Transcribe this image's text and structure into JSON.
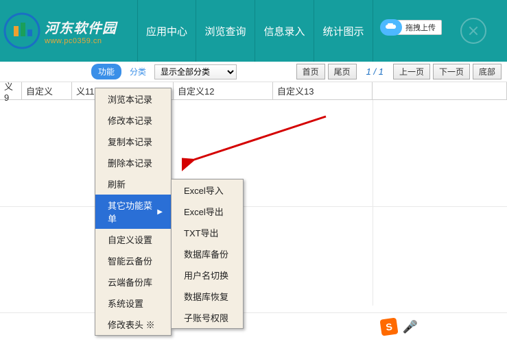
{
  "header": {
    "logo_title": "河东软件园",
    "logo_url": "www.pc0359.cn",
    "nav": [
      "应用中心",
      "浏览查询",
      "信息录入",
      "统计图示"
    ],
    "upload": "拖拽上传"
  },
  "toolbar": {
    "func_btn": "功能",
    "category_btn": "分类",
    "select_value": "显示全部分类",
    "first_page": "首页",
    "last_page": "尾页",
    "page_info": "1 / 1",
    "prev": "上一页",
    "next": "下一页",
    "bottom": "底部"
  },
  "table": {
    "headers": [
      "义9",
      "自定义",
      "义11",
      "自定义12",
      "自定义13"
    ]
  },
  "menu1": {
    "items": [
      {
        "label": "浏览本记录",
        "hl": false
      },
      {
        "label": "修改本记录",
        "hl": false
      },
      {
        "label": "复制本记录",
        "hl": false
      },
      {
        "label": "删除本记录",
        "hl": false
      },
      {
        "label": "刷新",
        "hl": false
      },
      {
        "label": "其它功能菜单",
        "hl": true,
        "arrow": true
      },
      {
        "label": "自定义设置",
        "hl": false
      },
      {
        "label": "智能云备份",
        "hl": false
      },
      {
        "label": "云端备份库",
        "hl": false
      },
      {
        "label": "系统设置",
        "hl": false
      },
      {
        "label": "修改表头 ※",
        "hl": false
      }
    ]
  },
  "menu2": {
    "items": [
      {
        "label": "Excel导入"
      },
      {
        "label": "Excel导出"
      },
      {
        "label": "TXT导出"
      },
      {
        "label": "数据库备份"
      },
      {
        "label": "用户名切换"
      },
      {
        "label": "数据库恢复"
      },
      {
        "label": "子账号权限"
      }
    ]
  },
  "ime": {
    "brand": "S"
  }
}
